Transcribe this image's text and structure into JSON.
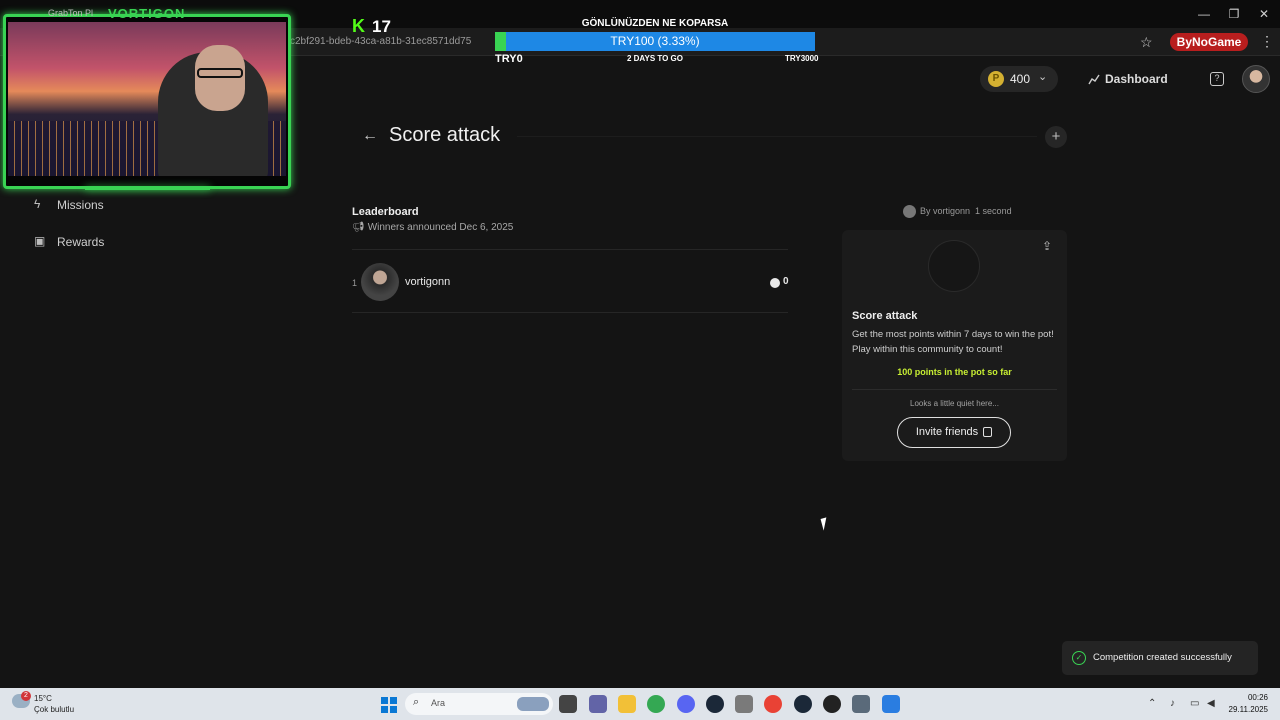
{
  "browser": {
    "url_fragment": "c2bf291-bdeb-43ca-a81b-31ec8571dd75",
    "extension_label": "ByNoGame",
    "window_controls": [
      "—",
      "❐",
      "✕"
    ]
  },
  "stream_overlay": {
    "kick_count": "17",
    "donation_title": "GÖNLÜNÜZDEN NE KOPARSA",
    "donation_progress_text": "TRY100 (3.33%)",
    "donation_fraction": 0.0333,
    "donation_min": "TRY0",
    "donation_days": "2 DAYS TO GO",
    "donation_max": "TRY3000",
    "webcam_brand": "VORTIGON",
    "webcam_tab_label": "GrabTon Pl"
  },
  "header": {
    "coins": "400",
    "dashboard_label": "Dashboard"
  },
  "sidebar": {
    "items": [
      {
        "label": "Missions",
        "icon": "bolt-icon"
      },
      {
        "label": "Rewards",
        "icon": "gift-icon"
      }
    ]
  },
  "main": {
    "title": "Score attack",
    "leaderboard": {
      "title": "Leaderboard",
      "subtitle": "Winners announced Dec 6, 2025",
      "rows": [
        {
          "rank": "1",
          "name": "vortigonn",
          "score": "0"
        }
      ]
    }
  },
  "card": {
    "by_line": "By vortigonn · 1 second",
    "by_user": "By vortigonn",
    "by_time": "1 second",
    "title": "Score attack",
    "description": "Get the most points within 7 days to win the pot! Play within this community to count!",
    "pot_text": "100 points in the pot so far",
    "quiet_text": "Looks a little quiet here...",
    "invite_label": "Invite friends"
  },
  "toast": {
    "message": "Competition created successfully"
  },
  "taskbar": {
    "weather_badge": "2",
    "temperature": "15°C",
    "weather_desc": "Çok bulutlu",
    "search_placeholder": "Ara",
    "time": "00:26",
    "date": "29.11.2025"
  },
  "colors": {
    "accent_green": "#39d353",
    "pot_yellow": "#c7ee33",
    "donation_blue": "#1e88e5"
  }
}
